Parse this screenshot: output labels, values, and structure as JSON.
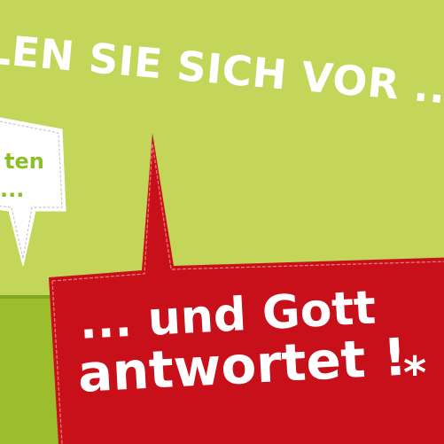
{
  "headline": "LEN SIE SICH VOR ...",
  "small_bubble": {
    "line1": "ten",
    "line2": "..."
  },
  "red_bubble": {
    "line1": "... und Gott",
    "line2": "antwortet !",
    "asterisk": "*"
  },
  "colors": {
    "background_upper": "#c3d65a",
    "background_lower": "#9cbe2c",
    "bubble_red": "#c8101a",
    "bubble_white": "#ffffff",
    "small_text_green": "#8cbf26"
  }
}
